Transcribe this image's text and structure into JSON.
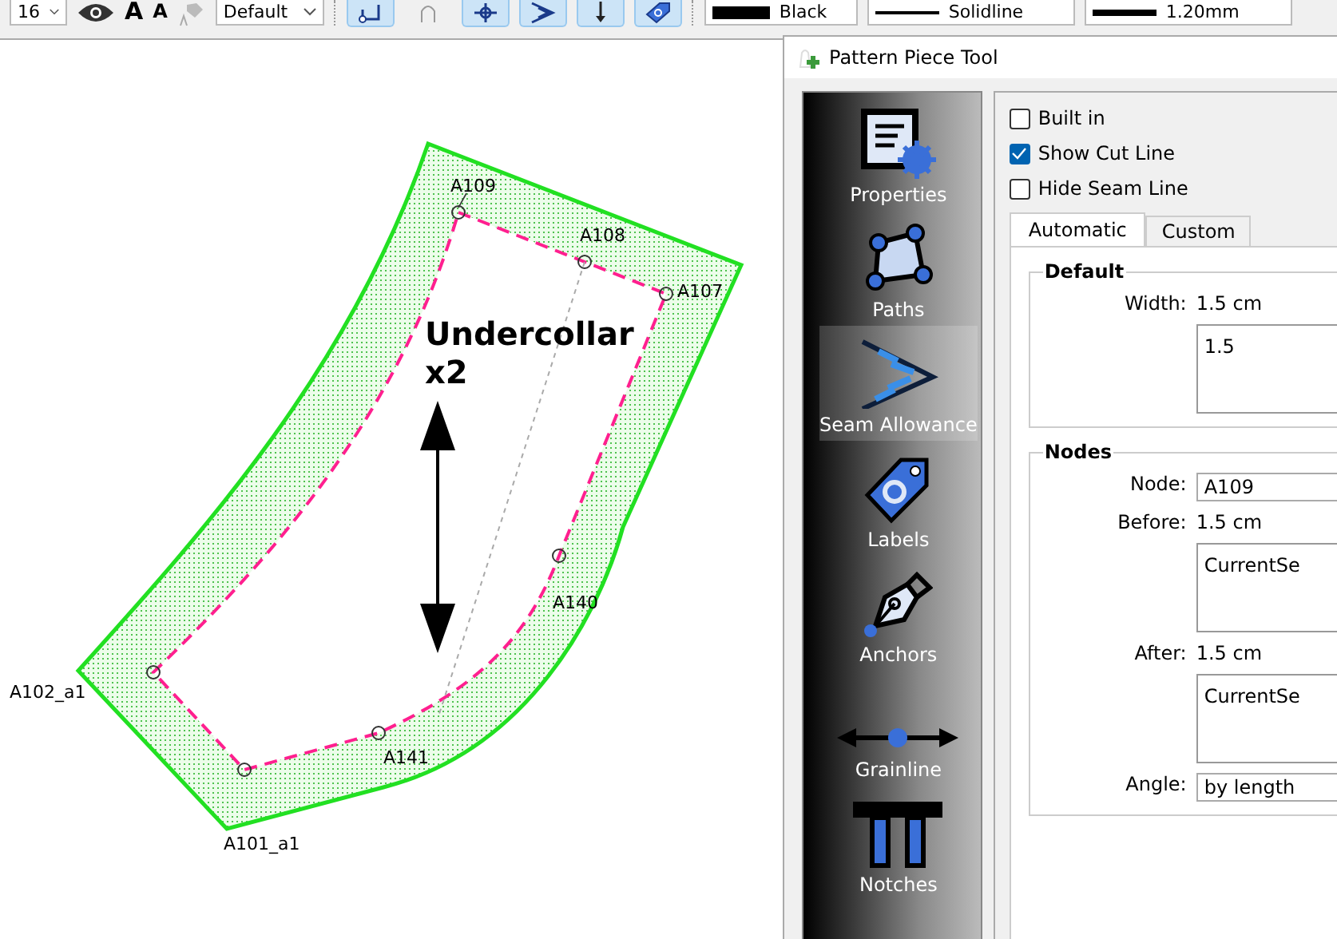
{
  "toolbar": {
    "font_size": "16",
    "text_buttons": [
      "A",
      "A"
    ],
    "label_font": "Default",
    "tools": [
      {
        "kind": "path",
        "selected": true
      },
      {
        "kind": "curve",
        "selected": false
      },
      {
        "kind": "point",
        "selected": true
      },
      {
        "kind": "seam",
        "selected": true
      },
      {
        "kind": "grain",
        "selected": true
      },
      {
        "kind": "label",
        "selected": true
      }
    ],
    "color_name": "Black",
    "line_style": "Solidline",
    "line_width_text": "1.20mm"
  },
  "canvas": {
    "piece_name": "Undercollar",
    "copies": "x2",
    "points": [
      {
        "name": "A109"
      },
      {
        "name": "A108"
      },
      {
        "name": "A107"
      },
      {
        "name": "A140"
      },
      {
        "name": "A141"
      },
      {
        "name": "A101_a1"
      },
      {
        "name": "A102_a1"
      }
    ]
  },
  "dialog": {
    "title": "Pattern Piece Tool",
    "sidebar": [
      {
        "label": "Properties",
        "kind": "properties",
        "selected": false
      },
      {
        "label": "Paths",
        "kind": "paths",
        "selected": false
      },
      {
        "label": "Seam Allowance",
        "kind": "seam",
        "selected": true
      },
      {
        "label": "Labels",
        "kind": "labels",
        "selected": false
      },
      {
        "label": "Anchors",
        "kind": "anchors",
        "selected": false
      },
      {
        "label": "Grainline",
        "kind": "grainline",
        "selected": false
      },
      {
        "label": "Notches",
        "kind": "notches",
        "selected": false
      }
    ],
    "checkboxes": [
      {
        "label": "Built in",
        "checked": false
      },
      {
        "label": "Show Cut Line",
        "checked": true
      },
      {
        "label": "Hide Seam Line",
        "checked": false
      }
    ],
    "tabs": [
      {
        "label": "Automatic",
        "selected": true
      },
      {
        "label": "Custom",
        "selected": false
      }
    ],
    "default_group": {
      "title": "Default",
      "width_label": "Width:",
      "width_value": "1.5 cm",
      "formula": "1.5"
    },
    "nodes_group": {
      "title": "Nodes",
      "node_label": "Node:",
      "node": "A109",
      "before_label": "Before:",
      "before_value": "1.5 cm",
      "before_formula": "CurrentSe",
      "after_label": "After:",
      "after_value": "1.5 cm",
      "after_formula": "CurrentSe",
      "angle_label": "Angle:",
      "angle": "by length"
    }
  }
}
